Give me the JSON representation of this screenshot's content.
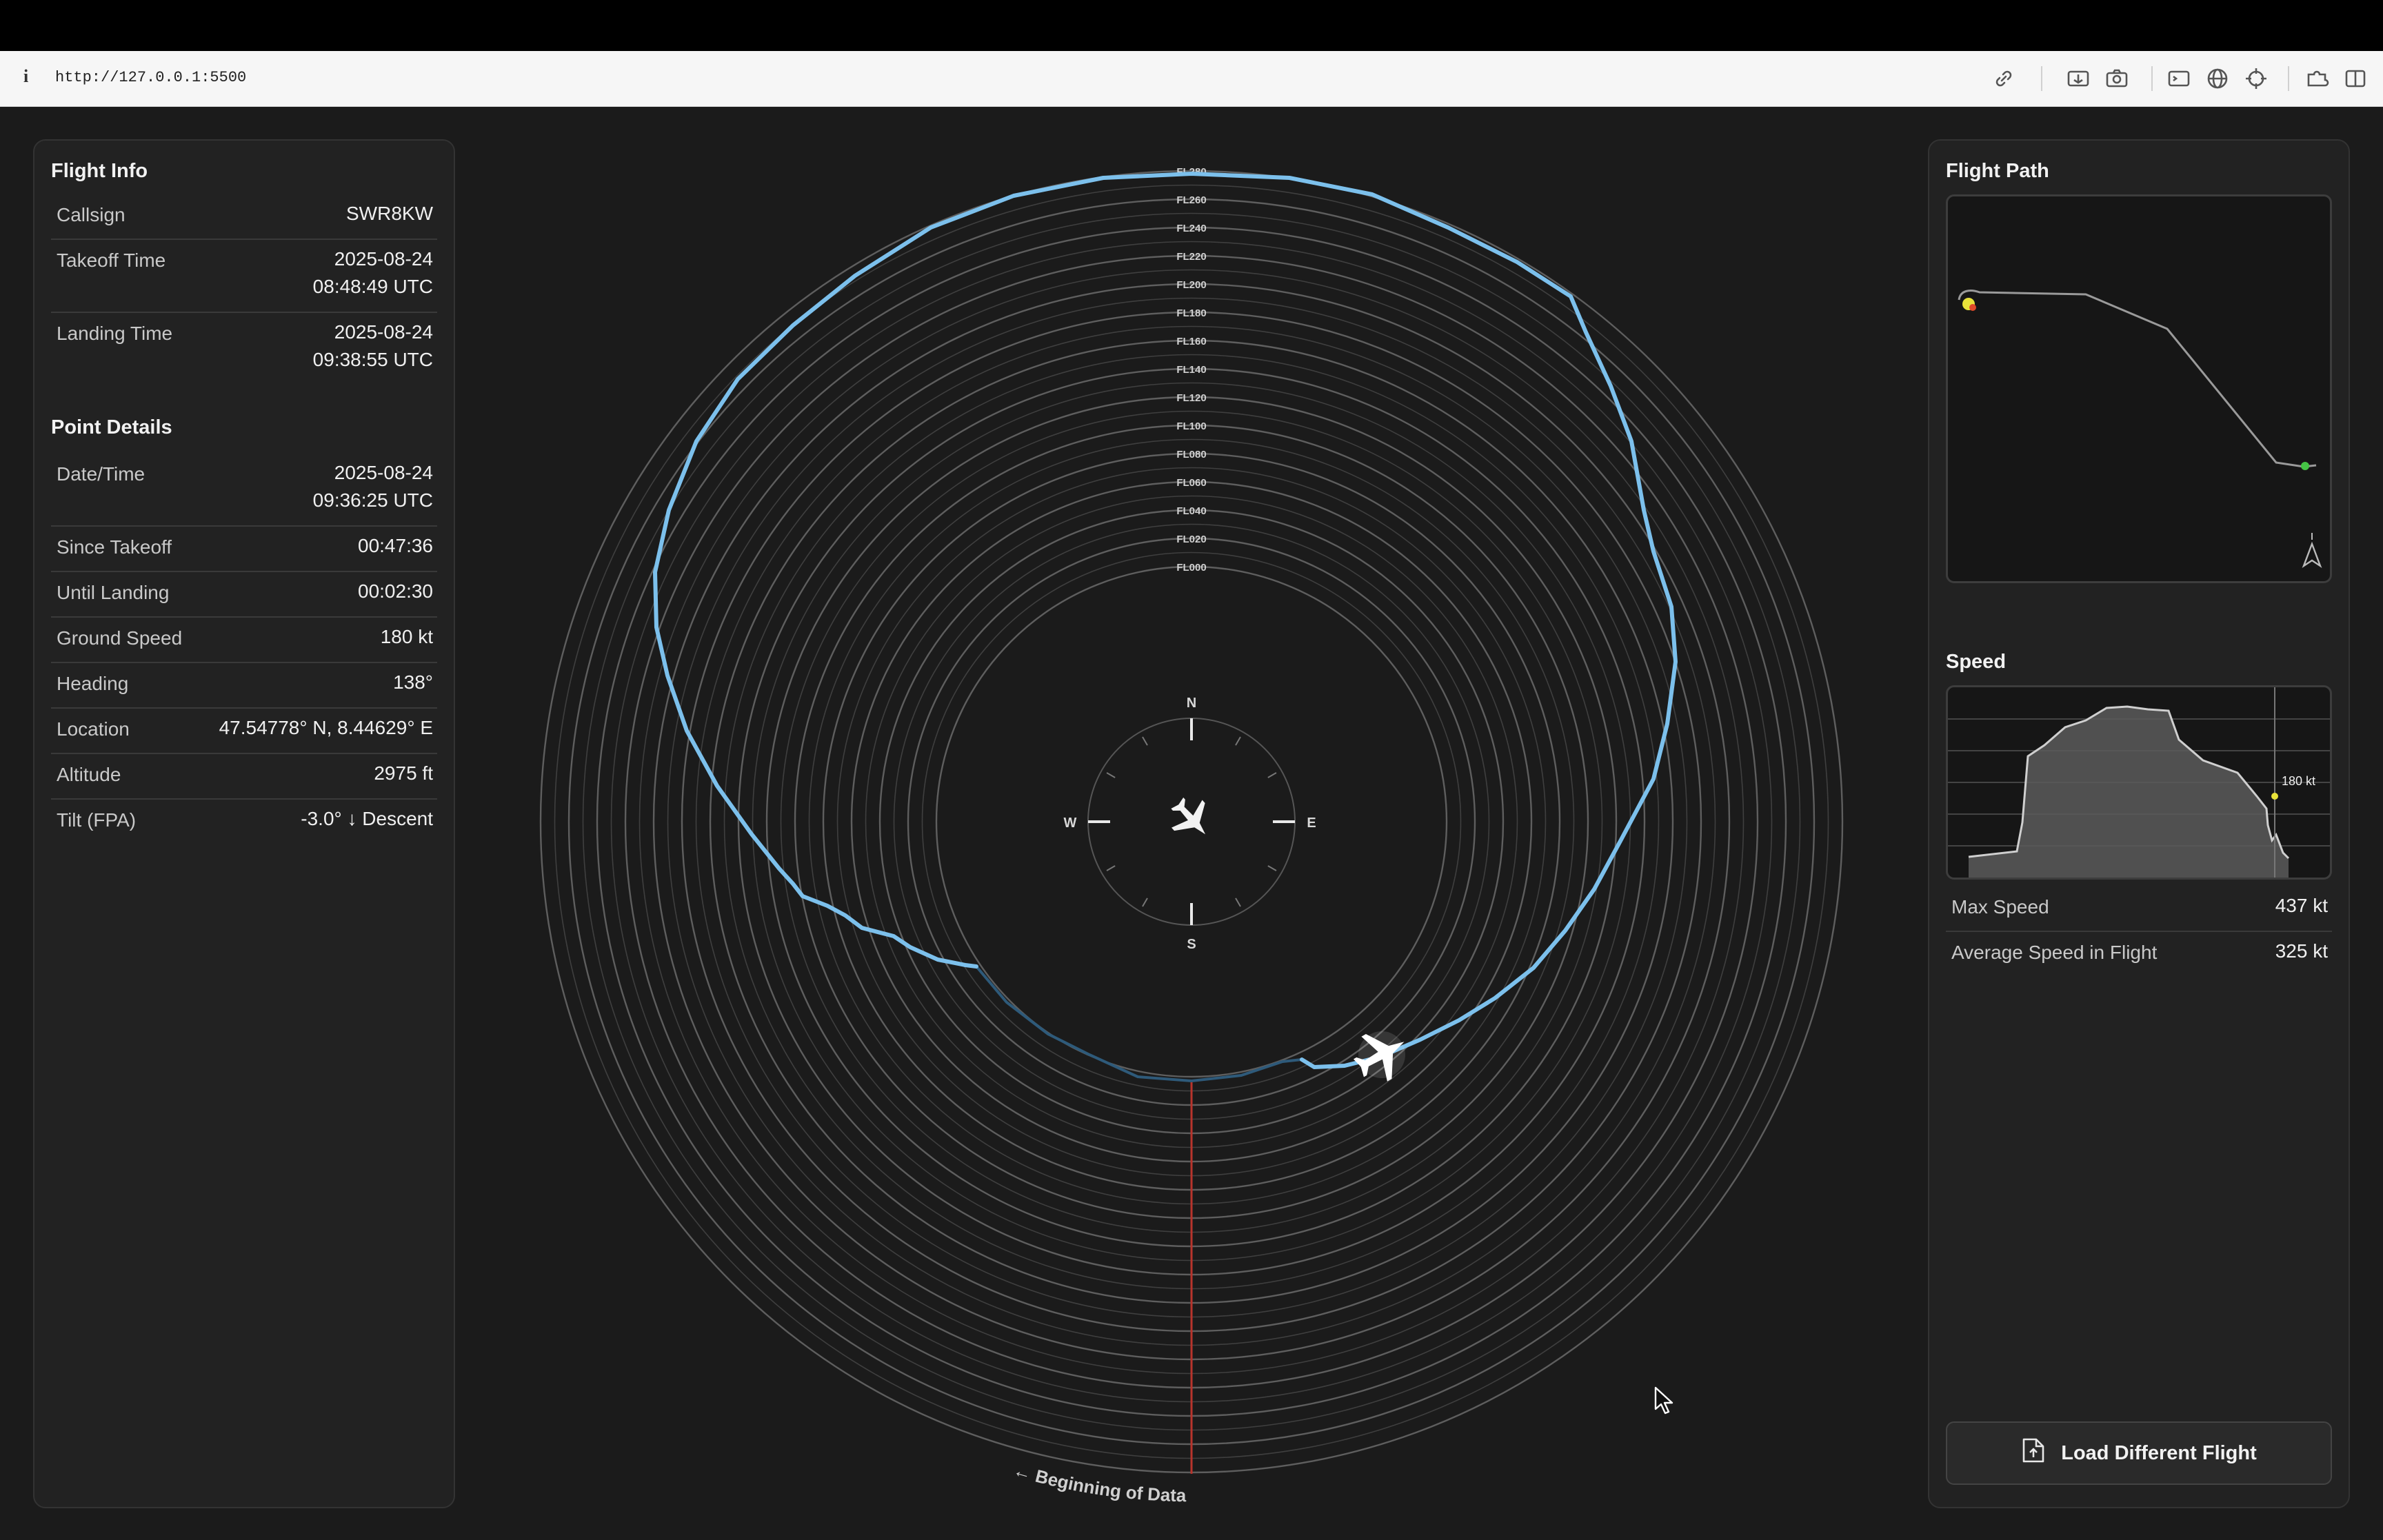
{
  "browser": {
    "url": "http://127.0.0.1:5500"
  },
  "flight_info": {
    "title": "Flight Info",
    "rows": [
      {
        "label": "Callsign",
        "value": "SWR8KW"
      },
      {
        "label": "Takeoff Time",
        "value_line1": "2025-08-24",
        "value_line2": "08:48:49 UTC"
      },
      {
        "label": "Landing Time",
        "value_line1": "2025-08-24",
        "value_line2": "09:38:55 UTC"
      }
    ]
  },
  "point_details": {
    "title": "Point Details",
    "rows": [
      {
        "label": "Date/Time",
        "value_line1": "2025-08-24",
        "value_line2": "09:36:25 UTC"
      },
      {
        "label": "Since Takeoff",
        "value": "00:47:36"
      },
      {
        "label": "Until Landing",
        "value": "00:02:30"
      },
      {
        "label": "Ground Speed",
        "value": "180 kt"
      },
      {
        "label": "Heading",
        "value": "138°"
      },
      {
        "label": "Location",
        "value": "47.54778° N, 8.44629° E"
      },
      {
        "label": "Altitude",
        "value": "2975 ft"
      },
      {
        "label": "Tilt (FPA)",
        "value": "-3.0° ↓ Descent"
      }
    ]
  },
  "flight_path": {
    "title": "Flight Path"
  },
  "speed": {
    "title": "Speed",
    "marker_label": "180 kt",
    "stats": [
      {
        "label": "Max Speed",
        "value": "437 kt"
      },
      {
        "label": "Average Speed in Flight",
        "value": "325 kt"
      }
    ]
  },
  "load_button": {
    "label": "Load Different Flight"
  },
  "radar": {
    "flight_levels": [
      "FL280",
      "FL260",
      "FL240",
      "FL220",
      "FL200",
      "FL180",
      "FL160",
      "FL140",
      "FL120",
      "FL100",
      "FL080",
      "FL060",
      "FL040",
      "FL020",
      "FL000"
    ],
    "compass": {
      "n": "N",
      "s": "S",
      "e": "E",
      "w": "W"
    },
    "heading_deg": 138,
    "beginning_label": "← Beginning of Data"
  },
  "colors": {
    "track": "#7cc0ec",
    "track_dim": "#2e5a7a",
    "ring": "#5a5a5a",
    "start_line": "#b8342c",
    "current_point": "#e8e23a",
    "end_point": "#45c445"
  }
}
